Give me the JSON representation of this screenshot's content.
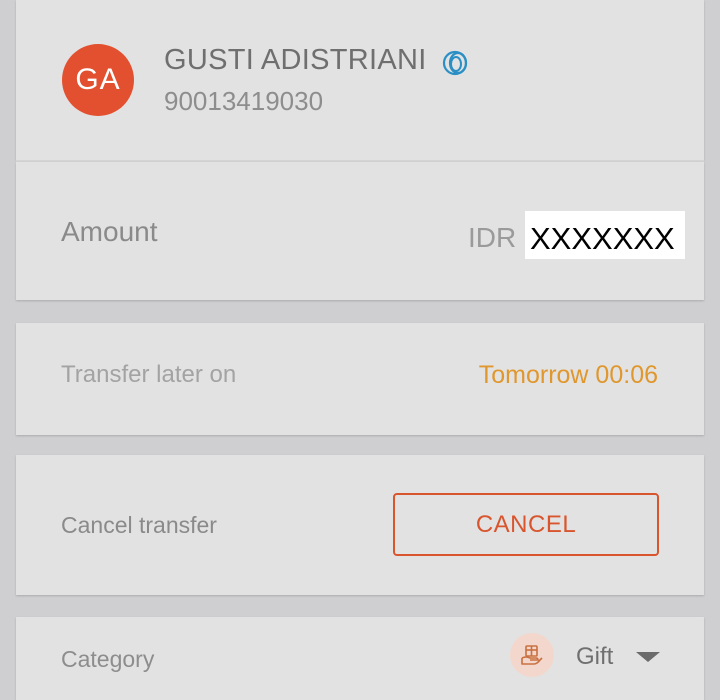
{
  "recipient": {
    "initials": "GA",
    "name": "GUSTI ADISTRIANI",
    "account_number": "90013419030",
    "verified_icon": "bank-logo-icon"
  },
  "amount": {
    "label": "Amount",
    "currency": "IDR",
    "value": "XXXXXXX"
  },
  "schedule": {
    "label": "Transfer later on",
    "value": "Tomorrow 00:06"
  },
  "cancel": {
    "label": "Cancel transfer",
    "button_label": "CANCEL"
  },
  "category": {
    "label": "Category",
    "selected": "Gift",
    "icon": "gift-hand-icon"
  },
  "colors": {
    "background": "#cfcfd2",
    "card": "#e2e2e2",
    "avatar": "#e2502f",
    "accent_orange": "#e0972d",
    "cancel_red": "#d9552e",
    "verified_blue": "#2a8fc4"
  }
}
